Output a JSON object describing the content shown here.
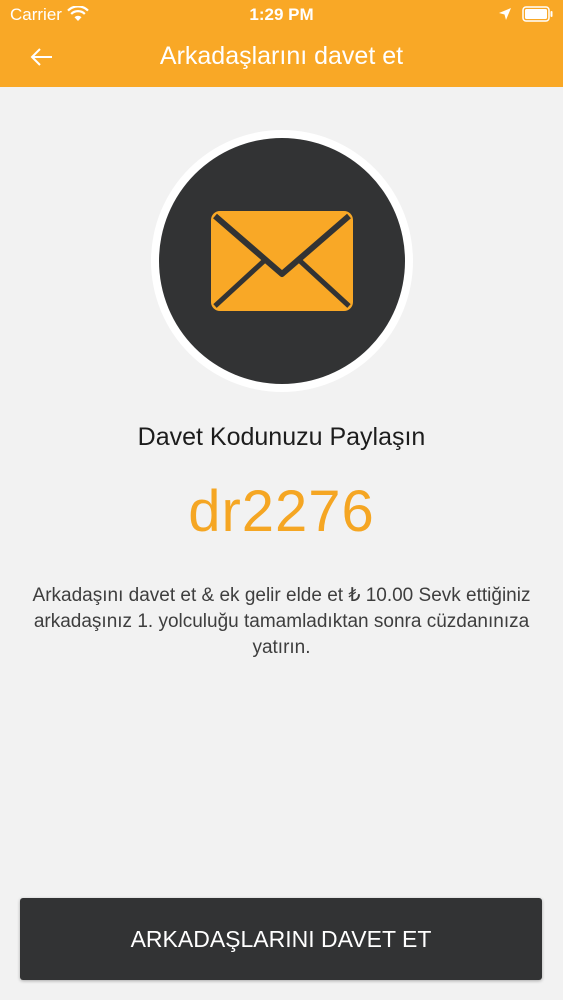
{
  "status_bar": {
    "carrier": "Carrier",
    "time": "1:29 PM",
    "icons": [
      "wifi-icon",
      "location-icon",
      "battery-icon"
    ]
  },
  "header": {
    "title": "Arkadaşlarını davet et",
    "back_icon": "arrow-left-icon"
  },
  "main": {
    "envelope_icon": "envelope-icon",
    "share_title": "Davet Kodunuzu Paylaşın",
    "invite_code": "dr2276",
    "description": "Arkadaşını davet et & ek gelir elde et ₺ 10.00 Sevk ettiğiniz arkadaşınız 1. yolculuğu tamamladıktan sonra cüzdanınıza yatırın."
  },
  "footer": {
    "invite_button_label": "ARKADAŞLARINI DAVET ET"
  },
  "colors": {
    "accent": "#f9a826",
    "code": "#f5a623",
    "dark": "#323334",
    "background": "#f2f2f2"
  }
}
